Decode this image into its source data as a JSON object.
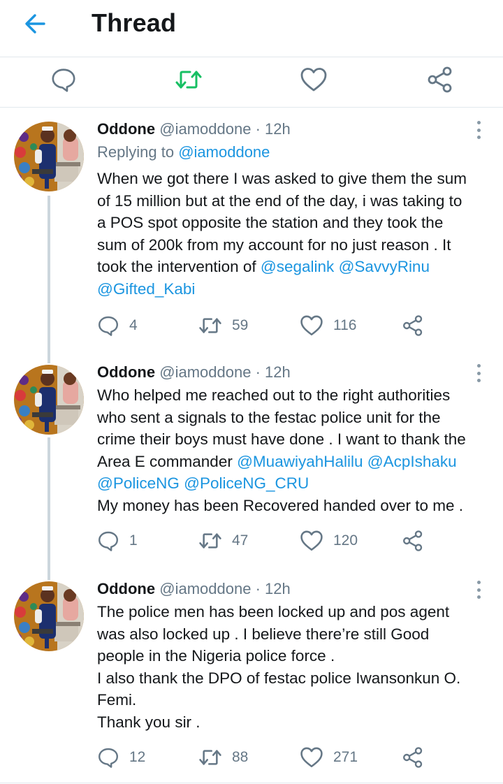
{
  "header": {
    "title": "Thread",
    "back_icon": "arrow-left-icon"
  },
  "actions": [
    {
      "name": "reply",
      "icon": "comment-icon",
      "color": "#657786"
    },
    {
      "name": "retweet",
      "icon": "retweet-icon",
      "color": "#17bf63"
    },
    {
      "name": "like",
      "icon": "heart-icon",
      "color": "#657786"
    },
    {
      "name": "share",
      "icon": "share-icon",
      "color": "#657786"
    }
  ],
  "colors": {
    "accent": "#1b95e0",
    "retweeted": "#17bf63",
    "muted": "#657786",
    "text": "#14171a"
  },
  "tweets": [
    {
      "name": "Oddone",
      "handle": "@iamoddone",
      "separator": "·",
      "time": "12h",
      "replying_label": "Replying to",
      "replying_to": "@iamoddone",
      "lines": [
        [
          {
            "t": "When we got there I was asked to give them the sum"
          }
        ],
        [
          {
            "t": "of 15 million but at the end of the day, i was taking to"
          }
        ],
        [
          {
            "t": "a POS spot opposite the station and they took the"
          }
        ],
        [
          {
            "t": "sum of 200k from my account for no just reason . It"
          }
        ],
        [
          {
            "t": "took the intervention of "
          },
          {
            "t": "@segalink",
            "m": true
          },
          {
            "t": " "
          },
          {
            "t": "@SavvyRinu",
            "m": true
          }
        ],
        [
          {
            "t": "@Gifted_Kabi",
            "m": true
          }
        ]
      ],
      "replies": "4",
      "retweets": "59",
      "likes": "116"
    },
    {
      "name": "Oddone",
      "handle": "@iamoddone",
      "separator": "·",
      "time": "12h",
      "lines": [
        [
          {
            "t": "Who helped me reached out to the right authorities"
          }
        ],
        [
          {
            "t": "who sent a signals to the festac police unit for the"
          }
        ],
        [
          {
            "t": "crime their boys must have done . I want to thank the"
          }
        ],
        [
          {
            "t": "Area E commander "
          },
          {
            "t": "@MuawiyahHalilu",
            "m": true
          },
          {
            "t": " "
          },
          {
            "t": "@AcpIshaku",
            "m": true
          }
        ],
        [
          {
            "t": "@PoliceNG",
            "m": true
          },
          {
            "t": " "
          },
          {
            "t": "@PoliceNG_CRU",
            "m": true
          }
        ],
        [
          {
            "t": "My money has been Recovered handed over to me ."
          }
        ]
      ],
      "replies": "1",
      "retweets": "47",
      "likes": "120"
    },
    {
      "name": "Oddone",
      "handle": "@iamoddone",
      "separator": "·",
      "time": "12h",
      "lines": [
        [
          {
            "t": "The police men has been locked up and pos agent"
          }
        ],
        [
          {
            "t": "was also locked up . I believe there’re still Good"
          }
        ],
        [
          {
            "t": "people in the Nigeria police force ."
          }
        ],
        [
          {
            "t": "I also thank the DPO of festac police Iwansonkun O."
          }
        ],
        [
          {
            "t": "Femi."
          }
        ],
        [
          {
            "t": "Thank you sir ."
          }
        ]
      ],
      "replies": "12",
      "retweets": "88",
      "likes": "271"
    }
  ]
}
